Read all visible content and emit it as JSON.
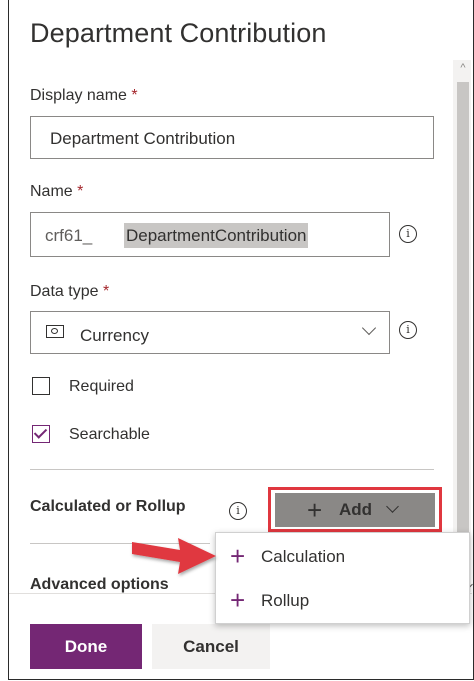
{
  "panel": {
    "title": "Department Contribution"
  },
  "display_name": {
    "label": "Display name",
    "required_mark": "*",
    "value": "Department Contribution"
  },
  "name": {
    "label": "Name",
    "required_mark": "*",
    "prefix": "crf61_",
    "value": "DepartmentContribution",
    "info_icon": "i"
  },
  "data_type": {
    "label": "Data type",
    "required_mark": "*",
    "value": "Currency",
    "icon": "currency-icon",
    "info_icon": "i"
  },
  "checkboxes": {
    "required": {
      "label": "Required",
      "checked": false
    },
    "searchable": {
      "label": "Searchable",
      "checked": true
    }
  },
  "calculated": {
    "label": "Calculated or Rollup",
    "info_icon": "i",
    "add_plus": "+",
    "add_label": "Add"
  },
  "menu": {
    "items": [
      {
        "plus": "+",
        "label": "Calculation"
      },
      {
        "plus": "+",
        "label": "Rollup"
      }
    ]
  },
  "advanced": {
    "label": "Advanced options"
  },
  "footer": {
    "done_label": "Done",
    "cancel_label": "Cancel"
  },
  "colors": {
    "accent": "#742774",
    "highlight": "#e0373f",
    "required": "#a4262c"
  }
}
